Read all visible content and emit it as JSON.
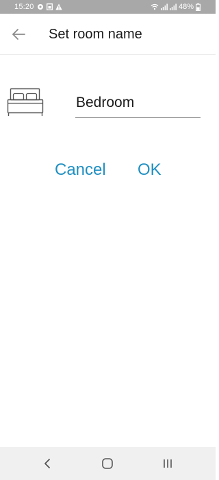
{
  "status_bar": {
    "time": "15:20",
    "battery": "48%",
    "icons_left": [
      "settings-gear-icon",
      "sim-card-icon",
      "warning-icon"
    ],
    "icons_right": [
      "wifi-icon",
      "signal-icon",
      "signal-icon"
    ]
  },
  "app_bar": {
    "back_icon": "arrow-left-icon",
    "title": "Set room name"
  },
  "room": {
    "icon": "bed-icon",
    "name_value": "Bedroom"
  },
  "actions": {
    "cancel_label": "Cancel",
    "ok_label": "OK"
  },
  "nav_bar": {
    "items": [
      "back-chevron-icon",
      "home-icon",
      "recents-icon"
    ]
  },
  "colors": {
    "accent": "#1f8fc2",
    "status_bar_bg": "#a8a8a8",
    "nav_bar_bg": "#f0f0f0",
    "title_text": "#1a1a1a"
  }
}
